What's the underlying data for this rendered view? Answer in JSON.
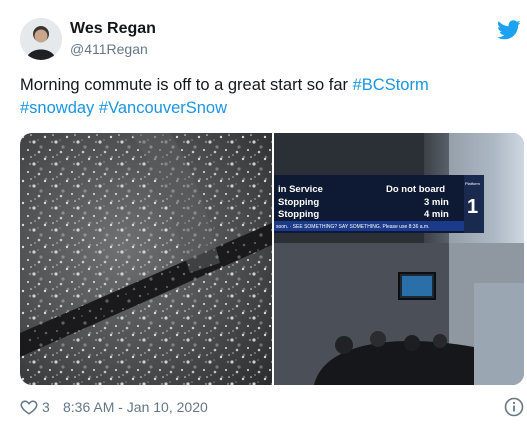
{
  "author": {
    "display_name": "Wes Regan",
    "handle": "@411Regan"
  },
  "tweet": {
    "text_plain": "Morning commute is off to a great start so far ",
    "hashtags": [
      "#BCStorm",
      "#snowday",
      "#VancouverSnow"
    ]
  },
  "media": {
    "right_photo_sign": {
      "row1_left": "in Service",
      "row1_right": "Do not board",
      "row2_left": "Stopping",
      "row2_right": "3 min",
      "row3_left": "Stopping",
      "row3_right": "4 min",
      "ticker": "soon. · SEE SOMETHING? SAY SOMETHING. Please use 8:36 a.m.",
      "platform_label": "Platform",
      "platform_number": "1"
    }
  },
  "footer": {
    "like_count": "3",
    "timestamp": "8:36 AM - Jan 10, 2020"
  },
  "icons": {
    "brand": "twitter-bird-icon",
    "like": "heart-icon",
    "info": "info-icon"
  },
  "colors": {
    "brand_blue": "#1da1f2",
    "hashtag_blue": "#1b95e0",
    "secondary_text": "#657786"
  }
}
